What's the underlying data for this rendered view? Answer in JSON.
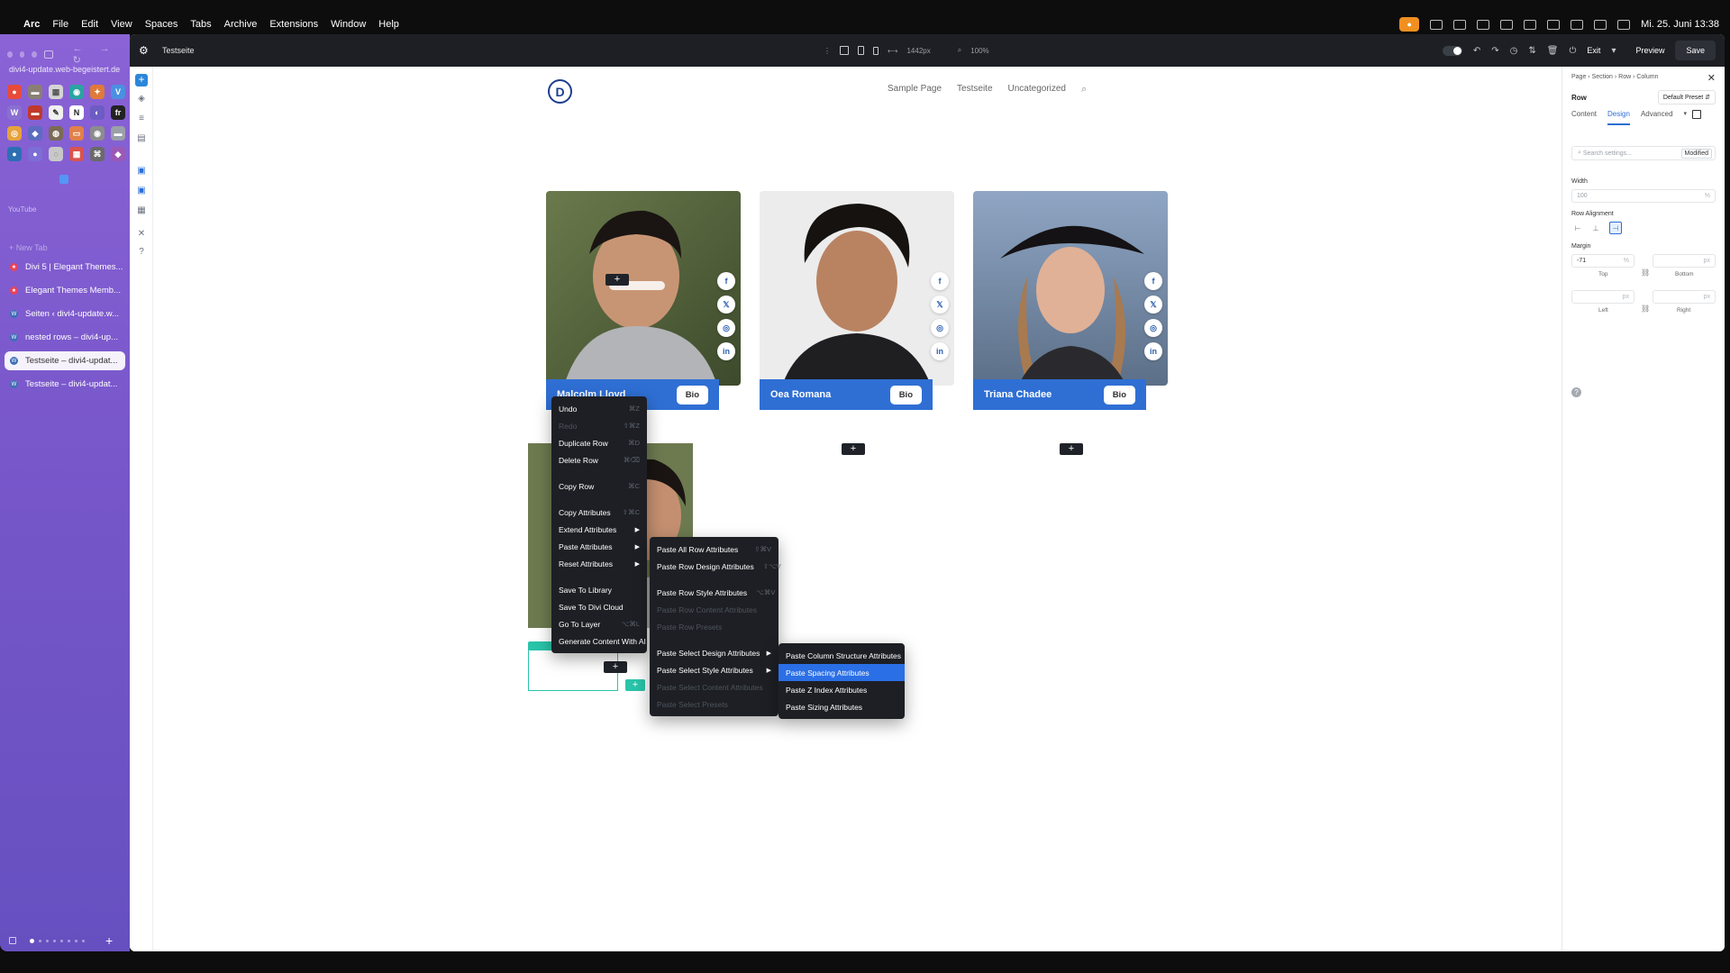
{
  "menubar": {
    "apple": "",
    "app": "Arc",
    "items": [
      "File",
      "Edit",
      "View",
      "Spaces",
      "Tabs",
      "Archive",
      "Extensions",
      "Window",
      "Help"
    ],
    "datetime": "Mi. 25. Juni 13:38"
  },
  "sidebar": {
    "url": "divi4-update.web-begeistert.de",
    "section_label": "YouTube",
    "new_tab": "+ New Tab",
    "tabs": [
      {
        "label": "Divi 5 | Elegant Themes...",
        "color": "#e8425a"
      },
      {
        "label": "Elegant Themes Memb...",
        "color": "#e8425a"
      },
      {
        "label": "Seiten ‹ divi4-update.w...",
        "color": "#3d6fb6"
      },
      {
        "label": "nested rows – divi4-up...",
        "color": "#3d6fb6"
      },
      {
        "label": "Testseite – divi4-updat...",
        "color": "#3d6fb6"
      },
      {
        "label": "Testseite – divi4-updat...",
        "color": "#3d6fb6"
      }
    ],
    "active_tab": 4
  },
  "toolbar": {
    "page_title": "Testseite",
    "width_readout": "1442px",
    "zoom": "100%",
    "exit": "Exit",
    "preview": "Preview",
    "save": "Save"
  },
  "site": {
    "logo_letter": "D",
    "nav": [
      "Sample Page",
      "Testseite",
      "Uncategorized"
    ]
  },
  "cards": [
    {
      "name": "Malcolm Lloyd",
      "bio": "Bio"
    },
    {
      "name": "Oea Romana",
      "bio": "Bio"
    },
    {
      "name": "Triana Chadee",
      "bio": "Bio"
    }
  ],
  "context_menu": {
    "items": [
      {
        "label": "Undo",
        "shortcut": "⌘Z",
        "disabled": false
      },
      {
        "label": "Redo",
        "shortcut": "⇧⌘Z",
        "disabled": true
      },
      {
        "label": "Duplicate Row",
        "shortcut": "⌘D",
        "disabled": false
      },
      {
        "label": "Delete Row",
        "shortcut": "⌘⌫",
        "disabled": false
      },
      {
        "label": "Copy Row",
        "shortcut": "⌘C",
        "disabled": false
      },
      {
        "label": "Copy Attributes",
        "shortcut": "⇧⌘C",
        "disabled": false
      },
      {
        "label": "Extend Attributes",
        "submenu": true
      },
      {
        "label": "Paste Attributes",
        "submenu": true
      },
      {
        "label": "Reset Attributes",
        "submenu": true
      },
      {
        "label": "Save To Library"
      },
      {
        "label": "Save To Divi Cloud"
      },
      {
        "label": "Go To Layer",
        "shortcut": "⌥⌘L"
      },
      {
        "label": "Generate Content With AI"
      }
    ]
  },
  "paste_menu": {
    "items": [
      {
        "label": "Paste All Row Attributes",
        "shortcut": "⇧⌘V"
      },
      {
        "label": "Paste Row Design Attributes",
        "shortcut": "⇧⌥V"
      },
      {
        "label": "Paste Row Style Attributes",
        "shortcut": "⌥⌘V"
      },
      {
        "label": "Paste Row Content Attributes",
        "disabled": true
      },
      {
        "label": "Paste Row Presets",
        "disabled": true
      },
      {
        "label": "Paste Select Design Attributes",
        "submenu": true
      },
      {
        "label": "Paste Select Style Attributes",
        "submenu": true
      },
      {
        "label": "Paste Select Content Attributes",
        "disabled": true
      },
      {
        "label": "Paste Select Presets",
        "disabled": true
      }
    ]
  },
  "design_menu": {
    "items": [
      {
        "label": "Paste Column Structure Attributes"
      },
      {
        "label": "Paste Spacing Attributes",
        "selected": true
      },
      {
        "label": "Paste Z Index Attributes"
      },
      {
        "label": "Paste Sizing Attributes"
      }
    ]
  },
  "panel": {
    "breadcrumb": "Page › Section › Row › Column",
    "element": "Row",
    "preset": "Default Preset ⇵",
    "tabs": [
      "Content",
      "Design",
      "Advanced"
    ],
    "active_tab": "Design",
    "search_placeholder": "Search settings...",
    "modified": "Modified",
    "width_label": "Width",
    "width_value": "100",
    "width_unit": "%",
    "row_alignment_label": "Row Alignment",
    "margin_label": "Margin",
    "margin_top": "-71",
    "margin_top_unit": "%",
    "unit_px": "px",
    "top": "Top",
    "bottom": "Bottom",
    "left": "Left",
    "right": "Right"
  },
  "colors": {
    "accent": "#2b6fe6",
    "bar": "#2f6fd4",
    "green": "#29c4a9",
    "menu_bg": "#1d1f24"
  }
}
